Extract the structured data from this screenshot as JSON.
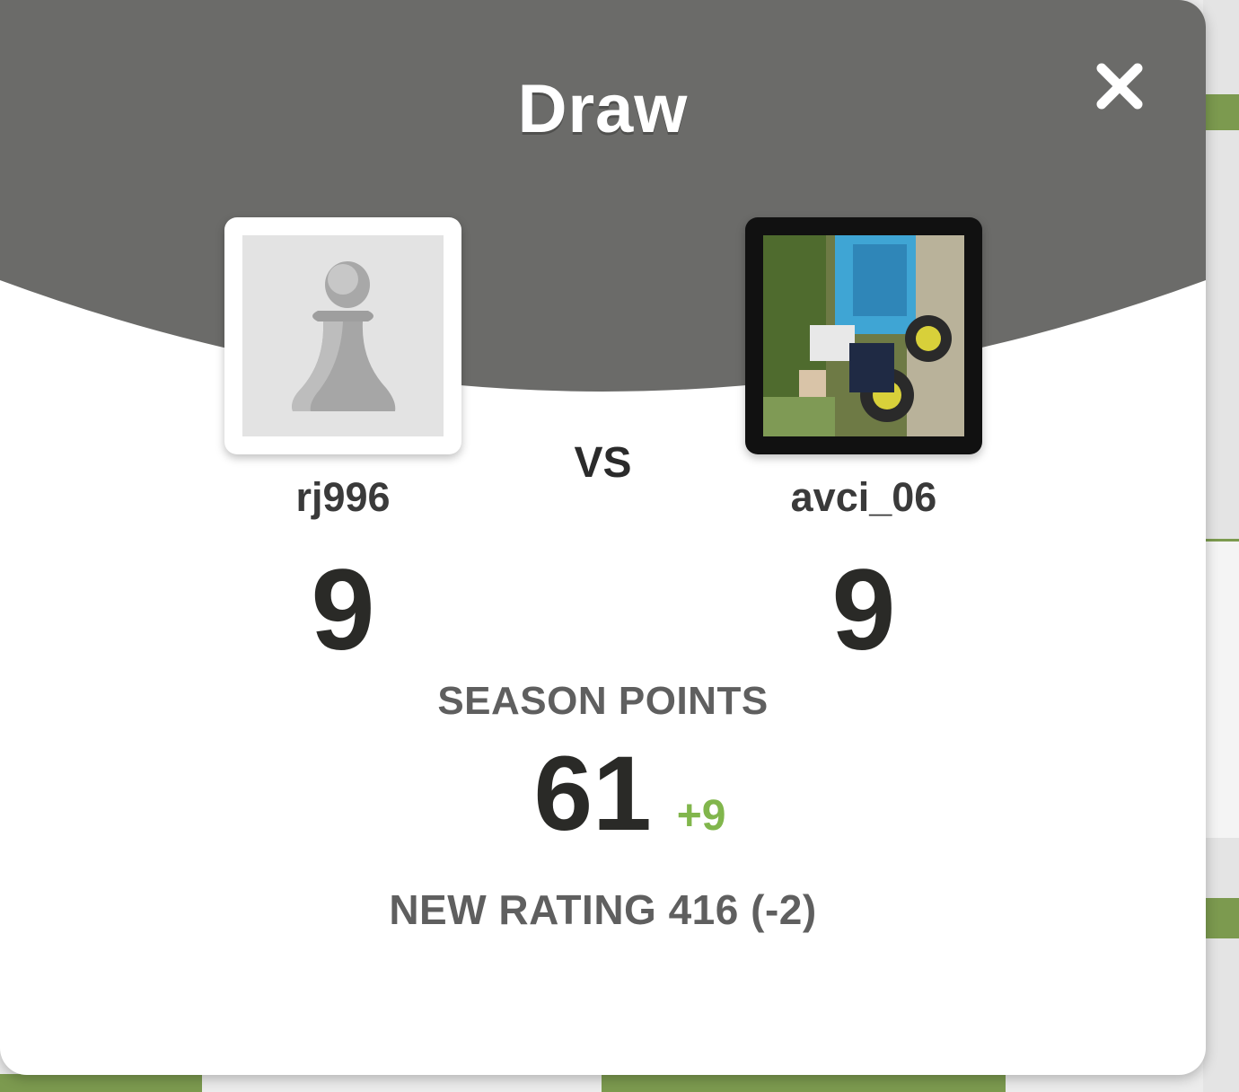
{
  "modal": {
    "title": "Draw",
    "close_icon": "close-icon",
    "vs_label": "VS",
    "players": [
      {
        "username": "rj996",
        "score": "9",
        "avatar": "pawn-placeholder-avatar"
      },
      {
        "username": "avci_06",
        "score": "9",
        "avatar": "photo-avatar"
      }
    ],
    "season": {
      "label": "SEASON POINTS",
      "value": "61",
      "delta": "+9"
    },
    "rating_text": "NEW RATING 416 (-2)"
  },
  "colors": {
    "header": "#6b6b69",
    "positive": "#81b64c",
    "board_green": "#7c9a4f"
  }
}
